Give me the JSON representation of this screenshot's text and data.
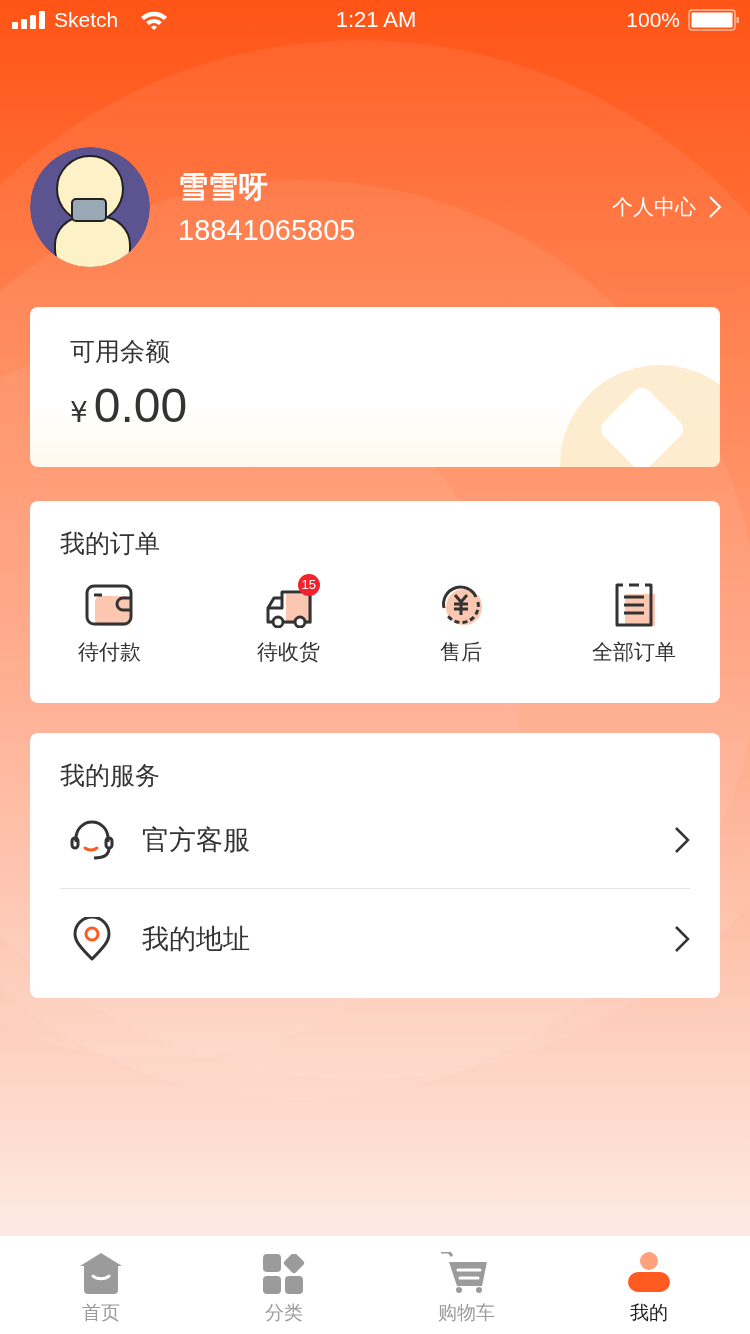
{
  "status_bar": {
    "carrier": "Sketch",
    "time": "1:21 AM",
    "battery": "100%"
  },
  "profile": {
    "name": "雪雪呀",
    "phone": "18841065805",
    "link": "个人中心"
  },
  "balance": {
    "label": "可用余额",
    "currency": "¥",
    "amount": "0.00"
  },
  "orders": {
    "title": "我的订单",
    "items": [
      {
        "kind": "wallet",
        "label": "待付款"
      },
      {
        "kind": "truck",
        "label": "待收货",
        "badge": "15"
      },
      {
        "kind": "refund",
        "label": "售后"
      },
      {
        "kind": "list",
        "label": "全部订单"
      }
    ]
  },
  "services": {
    "title": "我的服务",
    "items": [
      {
        "kind": "headset",
        "label": "官方客服"
      },
      {
        "kind": "pin",
        "label": "我的地址"
      }
    ]
  },
  "tab_bar": [
    {
      "kind": "home",
      "label": "首页",
      "selected": false
    },
    {
      "kind": "grid",
      "label": "分类",
      "selected": false
    },
    {
      "kind": "cart",
      "label": "购物车",
      "selected": false
    },
    {
      "kind": "user",
      "label": "我的",
      "selected": true
    }
  ]
}
